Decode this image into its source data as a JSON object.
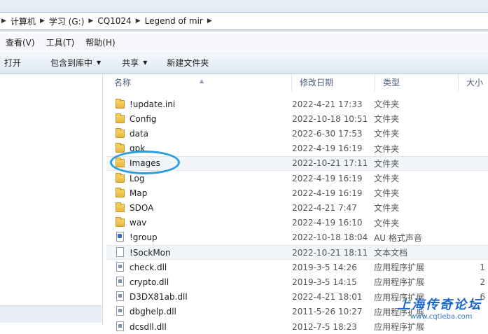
{
  "address_bar": {
    "breadcrumbs": [
      "计算机",
      "学习 (G:)",
      "CQ1024",
      "Legend of mir"
    ]
  },
  "menu": [
    "查看(V)",
    "工具(T)",
    "帮助(H)"
  ],
  "toolbar": {
    "open": "打开",
    "include_library": "包含到库中",
    "share": "共享",
    "new_folder": "新建文件夹"
  },
  "columns": {
    "name": "名称",
    "date": "修改日期",
    "type": "类型",
    "size": "大小"
  },
  "files": [
    {
      "name": "!update.ini",
      "date": "2022-4-21 17:33",
      "type": "文件夹",
      "size": "",
      "icon": "folder-icon"
    },
    {
      "name": "Config",
      "date": "2022-10-18 10:51",
      "type": "文件夹",
      "size": "",
      "icon": "folder-icon"
    },
    {
      "name": "data",
      "date": "2022-6-30 17:53",
      "type": "文件夹",
      "size": "",
      "icon": "folder-icon"
    },
    {
      "name": "gpk",
      "date": "2022-4-19 16:19",
      "type": "文件夹",
      "size": "",
      "icon": "folder-icon"
    },
    {
      "name": "Images",
      "date": "2022-10-21 17:11",
      "type": "文件夹",
      "size": "",
      "icon": "folder-icon",
      "highlight": true
    },
    {
      "name": "Log",
      "date": "2022-4-19 16:19",
      "type": "文件夹",
      "size": "",
      "icon": "folder-icon"
    },
    {
      "name": "Map",
      "date": "2022-4-19 16:19",
      "type": "文件夹",
      "size": "",
      "icon": "folder-icon"
    },
    {
      "name": "SDOA",
      "date": "2022-4-21 7:47",
      "type": "文件夹",
      "size": "",
      "icon": "folder-icon"
    },
    {
      "name": "wav",
      "date": "2022-4-19 16:10",
      "type": "文件夹",
      "size": "",
      "icon": "folder-icon"
    },
    {
      "name": "!group",
      "date": "2022-10-18 18:04",
      "type": "AU 格式声音",
      "size": "",
      "icon": "au-file-icon"
    },
    {
      "name": "!SockMon",
      "date": "2022-10-21 18:11",
      "type": "文本文档",
      "size": "",
      "icon": "text-file-icon",
      "highlight": true
    },
    {
      "name": "check.dll",
      "date": "2019-3-5 14:26",
      "type": "应用程序扩展",
      "size": "1",
      "icon": "dll-file-icon"
    },
    {
      "name": "crypto.dll",
      "date": "2019-3-5 14:15",
      "type": "应用程序扩展",
      "size": "2",
      "icon": "dll-file-icon"
    },
    {
      "name": "D3DX81ab.dll",
      "date": "2022-4-21 18:01",
      "type": "应用程序扩展",
      "size": "6",
      "icon": "dll-file-icon"
    },
    {
      "name": "dbghelp.dll",
      "date": "2011-5-26 10:27",
      "type": "应用程序扩展",
      "size": "",
      "icon": "dll-file-icon"
    },
    {
      "name": "dcsdll.dll",
      "date": "2012-7-5 18:23",
      "type": "应用程序扩展",
      "size": "",
      "icon": "dll-file-icon"
    }
  ],
  "watermark": {
    "title": "上海传奇论坛",
    "url": "www.cqtieba.com"
  },
  "colors": {
    "highlight_ellipse": "#2a9de0",
    "watermark": "#1a66c9"
  }
}
